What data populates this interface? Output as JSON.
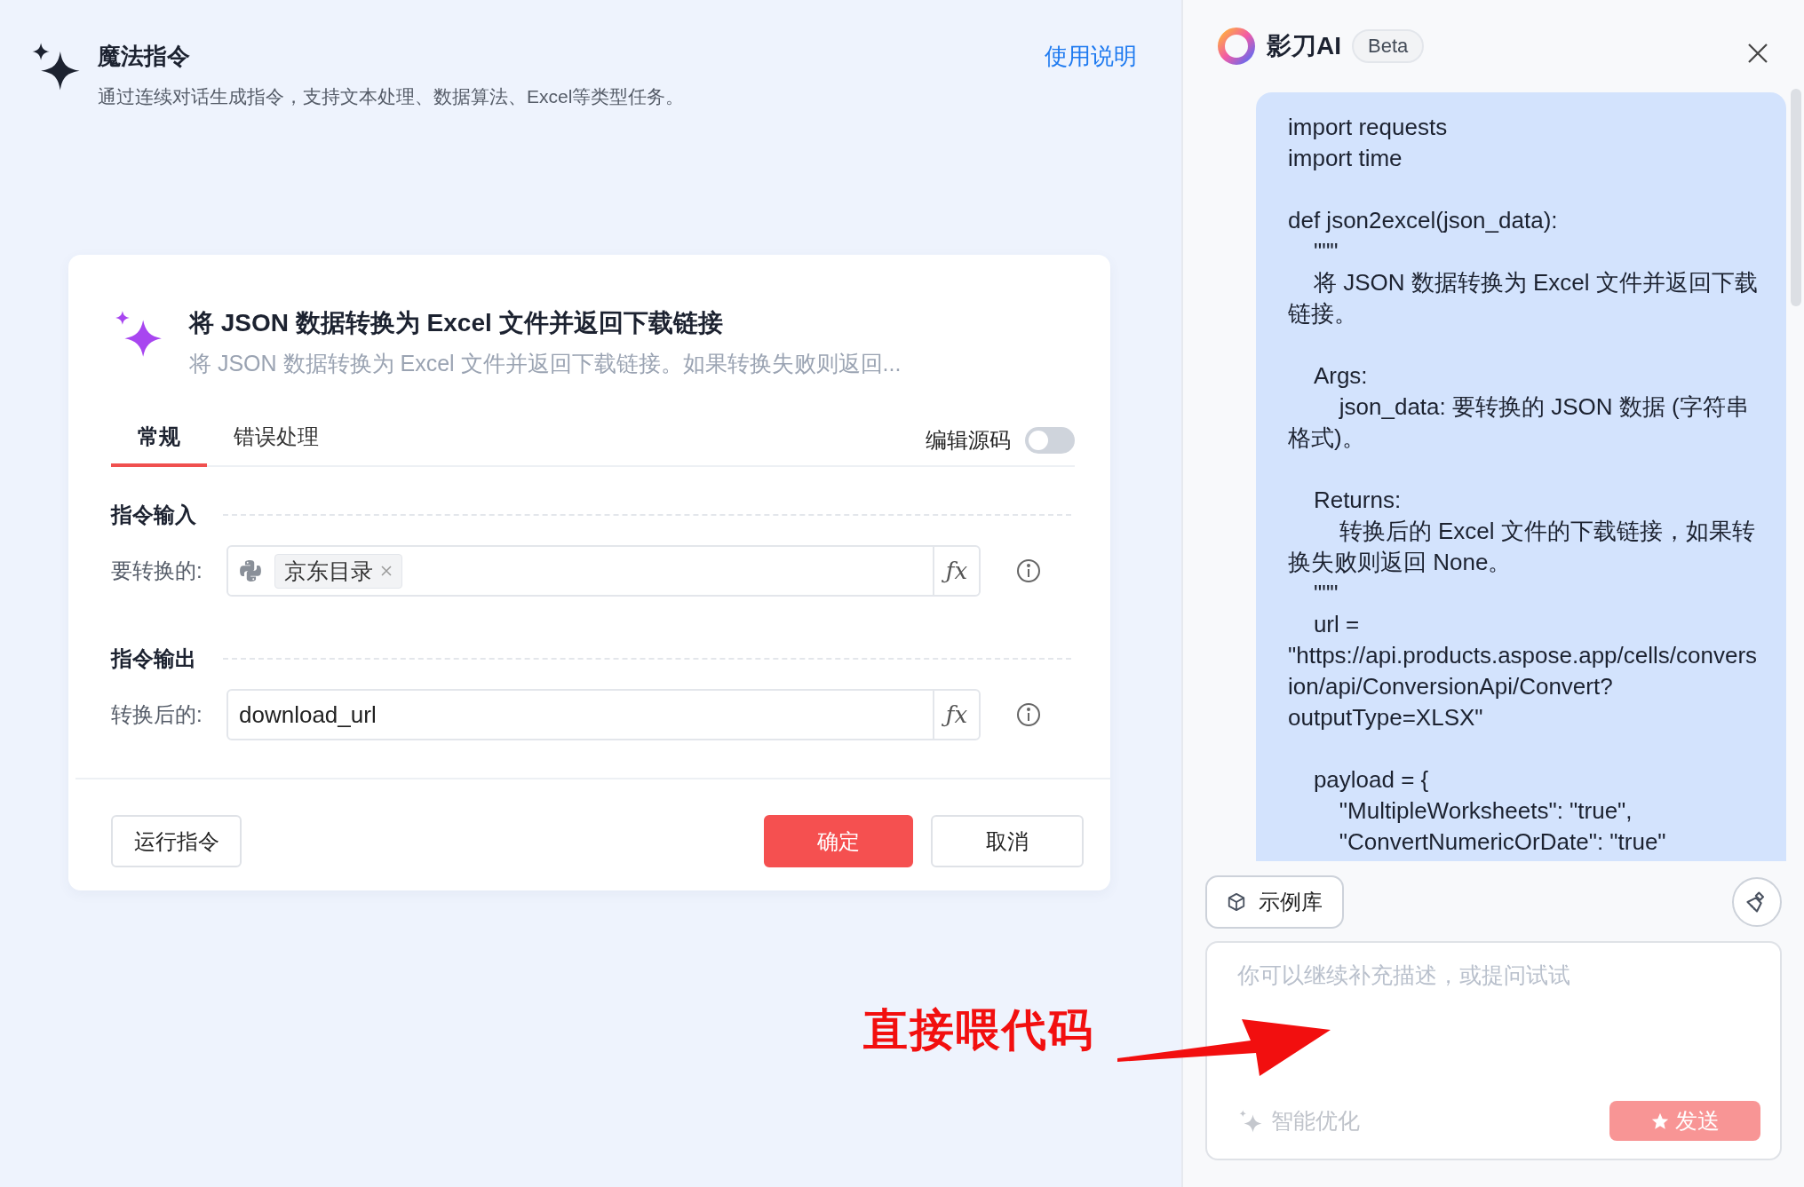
{
  "header": {
    "title": "魔法指令",
    "subtitle": "通过连续对话生成指令，支持文本处理、数据算法、Excel等类型任务。",
    "help_link": "使用说明"
  },
  "card": {
    "title": "将 JSON 数据转换为 Excel 文件并返回下载链接",
    "description": "将 JSON 数据转换为 Excel 文件并返回下载链接。如果转换失败则返回...",
    "tabs": [
      {
        "label": "常规",
        "selected": true
      },
      {
        "label": "错误处理",
        "selected": false
      }
    ],
    "source_toggle": {
      "label": "编辑源码",
      "on": false
    },
    "sections": [
      {
        "title": "指令输入",
        "fields": [
          {
            "label": "要转换的:",
            "kind": "tag",
            "tag": "京东目录",
            "fx": "ƒx"
          }
        ]
      },
      {
        "title": "指令输出",
        "fields": [
          {
            "label": "转换后的:",
            "kind": "text",
            "value": "download_url",
            "fx": "ƒx"
          }
        ]
      }
    ],
    "buttons": [
      {
        "label": "运行指令",
        "kind": "run"
      },
      {
        "label": "确定",
        "kind": "primary"
      },
      {
        "label": "取消",
        "kind": "cancel"
      }
    ]
  },
  "assistant": {
    "name": "影刀AI",
    "badge": "Beta",
    "message": "import requests\nimport time\n\ndef json2excel(json_data):\n    \"\"\"\n    将 JSON 数据转换为 Excel 文件并返回下载链接。\n\n    Args:\n        json_data: 要转换的 JSON 数据 (字符串格式)。\n\n    Returns:\n        转换后的 Excel 文件的下载链接，如果转换失败则返回 None。\n    \"\"\"\n    url = \"https://api.products.aspose.app/cells/conversion/api/ConversionApi/Convert?outputType=XLSX\"\n\n    payload = {\n        \"MultipleWorksheets\": \"true\",\n        \"ConvertNumericOrDate\": \"true\"",
    "examples_button": "示例库",
    "input": {
      "placeholder": "你可以继续补充描述，或提问试试"
    },
    "optimize": "智能优化",
    "send": {
      "label": "发送",
      "disabled": true
    }
  },
  "annotation": {
    "text": "直接喂代码"
  }
}
